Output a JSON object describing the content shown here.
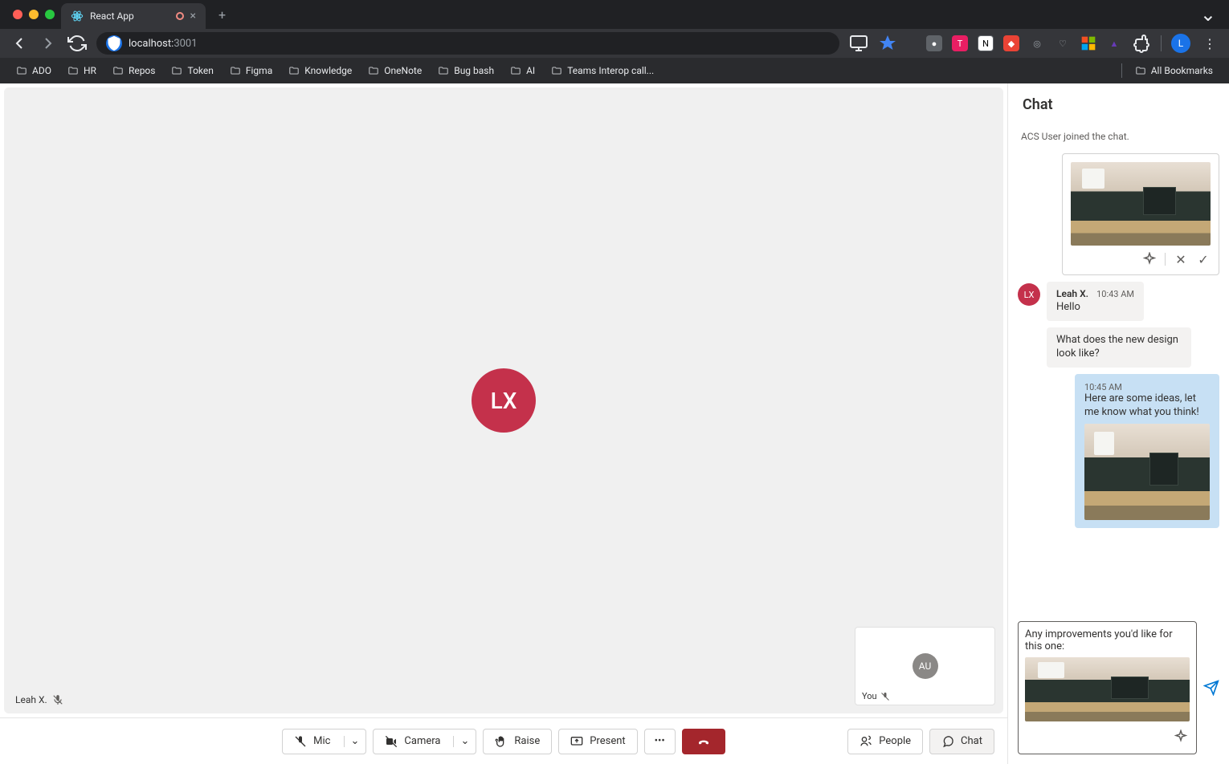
{
  "browser": {
    "tab_title": "React App",
    "url_host": "localhost:",
    "url_port": "3001",
    "bookmarks": [
      "ADO",
      "HR",
      "Repos",
      "Token",
      "Figma",
      "Knowledge",
      "OneNote",
      "Bug bash",
      "AI",
      "Teams Interop call..."
    ],
    "all_bookmarks": "All Bookmarks",
    "profile_initial": "L"
  },
  "call": {
    "remote_initials": "LX",
    "remote_name": "Leah X.",
    "self_label": "You",
    "self_initials": "AU"
  },
  "controls": {
    "mic": "Mic",
    "camera": "Camera",
    "raise": "Raise",
    "present": "Present",
    "people": "People",
    "chat": "Chat"
  },
  "chat": {
    "title": "Chat",
    "system_msg": "ACS User joined the chat.",
    "messages": [
      {
        "sender": "Leah X.",
        "initials": "LX",
        "time": "10:43 AM",
        "text": "Hello"
      },
      {
        "text": "What does the new design look like?"
      },
      {
        "time": "10:45 AM",
        "text": "Here are some ideas, let me know what you think!"
      }
    ],
    "compose_text": "Any improvements you'd like for this one:"
  }
}
